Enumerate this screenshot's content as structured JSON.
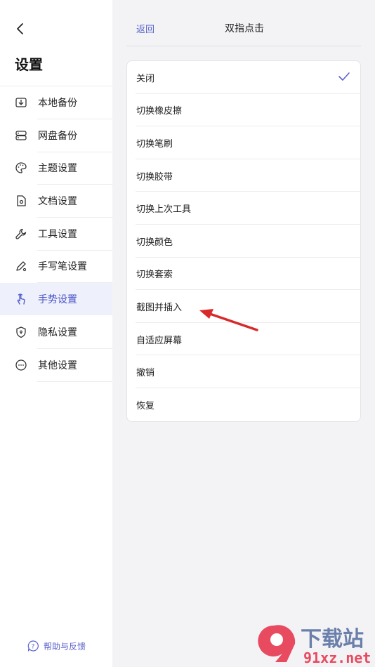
{
  "sidebar": {
    "title": "设置",
    "items": [
      {
        "label": "本地备份",
        "icon": "local-backup-icon"
      },
      {
        "label": "网盘备份",
        "icon": "cloud-drive-icon"
      },
      {
        "label": "主题设置",
        "icon": "palette-icon"
      },
      {
        "label": "文档设置",
        "icon": "document-settings-icon"
      },
      {
        "label": "工具设置",
        "icon": "wrench-icon"
      },
      {
        "label": "手写笔设置",
        "icon": "stylus-settings-icon"
      },
      {
        "label": "手势设置",
        "icon": "hand-gesture-icon",
        "active": true
      },
      {
        "label": "隐私设置",
        "icon": "shield-icon"
      },
      {
        "label": "其他设置",
        "icon": "more-icon"
      }
    ],
    "help_label": "帮助与反馈"
  },
  "header": {
    "back_label": "返回",
    "title": "双指点击"
  },
  "options": [
    {
      "label": "关闭",
      "selected": true
    },
    {
      "label": "切换橡皮擦"
    },
    {
      "label": "切换笔刷"
    },
    {
      "label": "切换胶带"
    },
    {
      "label": "切换上次工具"
    },
    {
      "label": "切换颜色"
    },
    {
      "label": "切换套索"
    },
    {
      "label": "截图并插入"
    },
    {
      "label": "自适应屏幕"
    },
    {
      "label": "撤销"
    },
    {
      "label": "恢复"
    }
  ],
  "colors": {
    "accent": "#5a63c9",
    "active_bg": "#eef0fb",
    "annotation_arrow": "#d92a2a"
  },
  "watermark": {
    "text": "下载站",
    "site": "91xz.net"
  }
}
